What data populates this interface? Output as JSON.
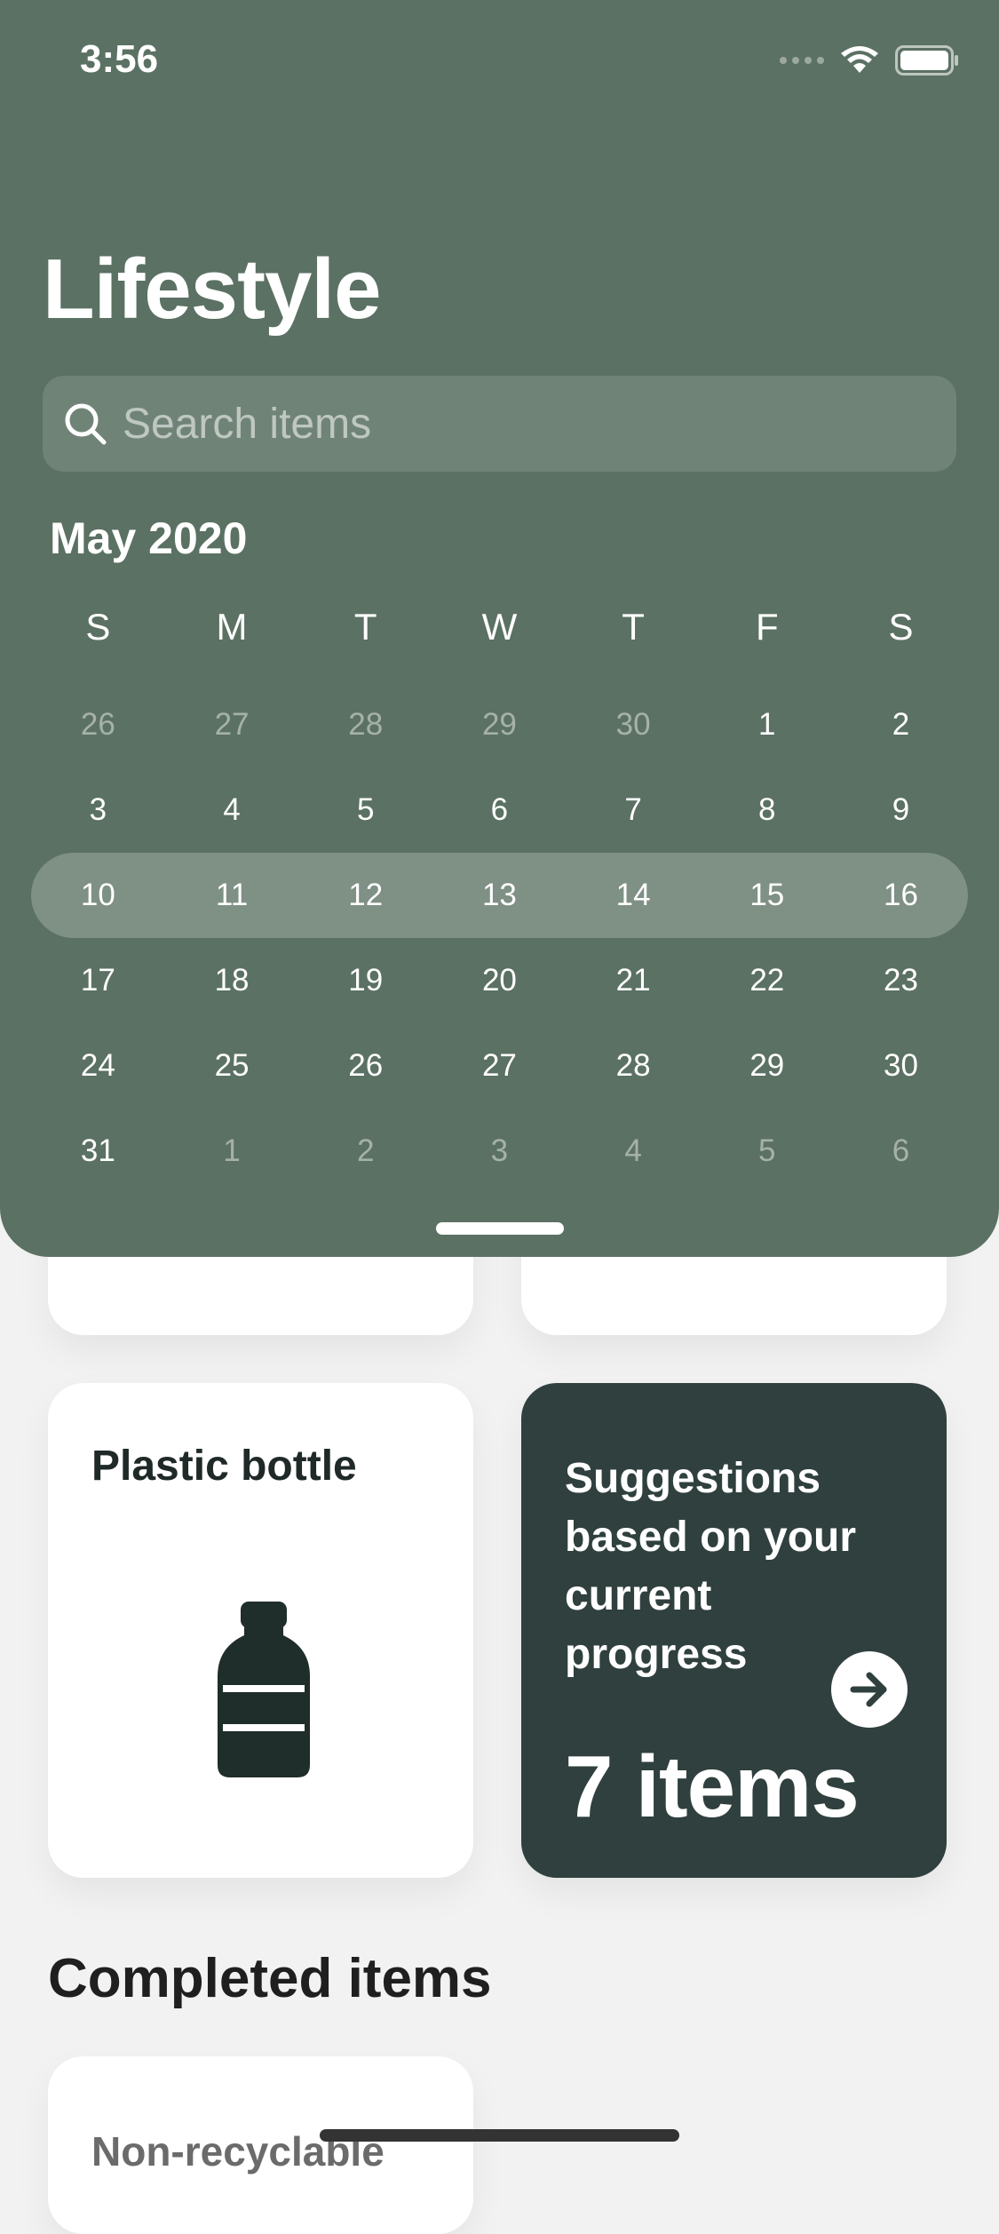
{
  "status_bar": {
    "time": "3:56"
  },
  "header": {
    "title": "Lifestyle"
  },
  "search": {
    "placeholder": "Search items",
    "value": ""
  },
  "calendar": {
    "month_label": "May 2020",
    "weekdays": [
      "S",
      "M",
      "T",
      "W",
      "T",
      "F",
      "S"
    ],
    "weeks": [
      {
        "days": [
          {
            "d": "26",
            "muted": true
          },
          {
            "d": "27",
            "muted": true
          },
          {
            "d": "28",
            "muted": true
          },
          {
            "d": "29",
            "muted": true
          },
          {
            "d": "30",
            "muted": true
          },
          {
            "d": "1",
            "muted": false
          },
          {
            "d": "2",
            "muted": false
          }
        ]
      },
      {
        "days": [
          {
            "d": "3",
            "muted": false
          },
          {
            "d": "4",
            "muted": false
          },
          {
            "d": "5",
            "muted": false
          },
          {
            "d": "6",
            "muted": false
          },
          {
            "d": "7",
            "muted": false
          },
          {
            "d": "8",
            "muted": false
          },
          {
            "d": "9",
            "muted": false
          }
        ]
      },
      {
        "selected": true,
        "days": [
          {
            "d": "10",
            "muted": false
          },
          {
            "d": "11",
            "muted": false
          },
          {
            "d": "12",
            "muted": false
          },
          {
            "d": "13",
            "muted": false
          },
          {
            "d": "14",
            "muted": false
          },
          {
            "d": "15",
            "muted": false
          },
          {
            "d": "16",
            "muted": false
          }
        ]
      },
      {
        "days": [
          {
            "d": "17",
            "muted": false
          },
          {
            "d": "18",
            "muted": false
          },
          {
            "d": "19",
            "muted": false
          },
          {
            "d": "20",
            "muted": false
          },
          {
            "d": "21",
            "muted": false
          },
          {
            "d": "22",
            "muted": false
          },
          {
            "d": "23",
            "muted": false
          }
        ]
      },
      {
        "days": [
          {
            "d": "24",
            "muted": false
          },
          {
            "d": "25",
            "muted": false
          },
          {
            "d": "26",
            "muted": false
          },
          {
            "d": "27",
            "muted": false
          },
          {
            "d": "28",
            "muted": false
          },
          {
            "d": "29",
            "muted": false
          },
          {
            "d": "30",
            "muted": false
          }
        ]
      },
      {
        "days": [
          {
            "d": "31",
            "muted": false
          },
          {
            "d": "1",
            "muted": true
          },
          {
            "d": "2",
            "muted": true
          },
          {
            "d": "3",
            "muted": true
          },
          {
            "d": "4",
            "muted": true
          },
          {
            "d": "5",
            "muted": true
          },
          {
            "d": "6",
            "muted": true
          }
        ]
      }
    ]
  },
  "cards": {
    "bottle": {
      "label": "Plastic bottle",
      "icon": "bottle-icon"
    },
    "suggestions": {
      "text": "Suggestions based on your current progress",
      "count": "7 items",
      "icon": "arrow-right-icon"
    }
  },
  "completed": {
    "title": "Completed items",
    "first_item": "Non-recyclable"
  },
  "colors": {
    "panel": "#5b7163",
    "suggestion_card": "#2f403e",
    "background": "#f2f2f2",
    "bottle": "#1f2d2b"
  }
}
